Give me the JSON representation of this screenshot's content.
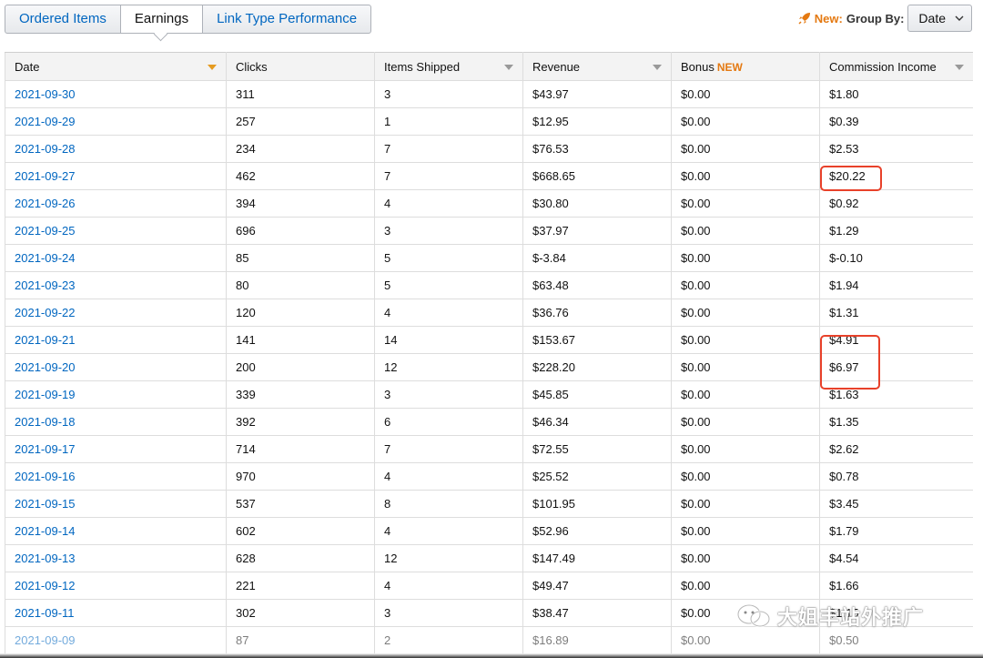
{
  "tabs": [
    {
      "label": "Ordered Items",
      "active": false
    },
    {
      "label": "Earnings",
      "active": true
    },
    {
      "label": "Link Type Performance",
      "active": false
    }
  ],
  "groupby": {
    "new_label": "New:",
    "label": "Group By:",
    "selected": "Date"
  },
  "table": {
    "columns": [
      {
        "label": "Date",
        "sort": "active"
      },
      {
        "label": "Clicks",
        "sort": "none"
      },
      {
        "label": "Items Shipped",
        "sort": "idle"
      },
      {
        "label": "Revenue",
        "sort": "idle"
      },
      {
        "label": "Bonus",
        "tag": "NEW",
        "sort": "none"
      },
      {
        "label": "Commission Income",
        "sort": "idle"
      }
    ],
    "rows": [
      [
        "2021-09-30",
        "311",
        "3",
        "$43.97",
        "$0.00",
        "$1.80"
      ],
      [
        "2021-09-29",
        "257",
        "1",
        "$12.95",
        "$0.00",
        "$0.39"
      ],
      [
        "2021-09-28",
        "234",
        "7",
        "$76.53",
        "$0.00",
        "$2.53"
      ],
      [
        "2021-09-27",
        "462",
        "7",
        "$668.65",
        "$0.00",
        "$20.22"
      ],
      [
        "2021-09-26",
        "394",
        "4",
        "$30.80",
        "$0.00",
        "$0.92"
      ],
      [
        "2021-09-25",
        "696",
        "3",
        "$37.97",
        "$0.00",
        "$1.29"
      ],
      [
        "2021-09-24",
        "85",
        "5",
        "$-3.84",
        "$0.00",
        "$-0.10"
      ],
      [
        "2021-09-23",
        "80",
        "5",
        "$63.48",
        "$0.00",
        "$1.94"
      ],
      [
        "2021-09-22",
        "120",
        "4",
        "$36.76",
        "$0.00",
        "$1.31"
      ],
      [
        "2021-09-21",
        "141",
        "14",
        "$153.67",
        "$0.00",
        "$4.91"
      ],
      [
        "2021-09-20",
        "200",
        "12",
        "$228.20",
        "$0.00",
        "$6.97"
      ],
      [
        "2021-09-19",
        "339",
        "3",
        "$45.85",
        "$0.00",
        "$1.63"
      ],
      [
        "2021-09-18",
        "392",
        "6",
        "$46.34",
        "$0.00",
        "$1.35"
      ],
      [
        "2021-09-17",
        "714",
        "7",
        "$72.55",
        "$0.00",
        "$2.62"
      ],
      [
        "2021-09-16",
        "970",
        "4",
        "$25.52",
        "$0.00",
        "$0.78"
      ],
      [
        "2021-09-15",
        "537",
        "8",
        "$101.95",
        "$0.00",
        "$3.45"
      ],
      [
        "2021-09-14",
        "602",
        "4",
        "$52.96",
        "$0.00",
        "$1.79"
      ],
      [
        "2021-09-13",
        "628",
        "12",
        "$147.49",
        "$0.00",
        "$4.54"
      ],
      [
        "2021-09-12",
        "221",
        "4",
        "$49.47",
        "$0.00",
        "$1.66"
      ],
      [
        "2021-09-11",
        "302",
        "3",
        "$38.47",
        "$0.00",
        "$1.15"
      ],
      [
        "2021-09-09",
        "87",
        "2",
        "$16.89",
        "$0.00",
        "$0.50"
      ]
    ]
  },
  "watermark": "大姐丰站外推广",
  "colors": {
    "link": "#0066c0",
    "accent_new": "#e47911",
    "highlight": "#e8412a"
  }
}
